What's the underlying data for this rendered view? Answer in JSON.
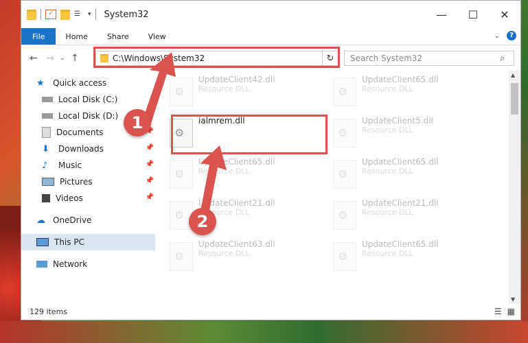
{
  "window": {
    "title": "System32"
  },
  "ribbon": {
    "tabs": [
      "File",
      "Home",
      "Share",
      "View"
    ]
  },
  "nav": {
    "address": "C:\\Windows\\System32",
    "search_placeholder": "Search System32"
  },
  "sidebar": {
    "items": [
      {
        "label": "Quick access",
        "icon": "star-icon"
      },
      {
        "label": "Local Disk (C:)",
        "icon": "drive-icon"
      },
      {
        "label": "Local Disk (D:)",
        "icon": "drive-icon"
      },
      {
        "label": "Documents",
        "icon": "documents-icon"
      },
      {
        "label": "Downloads",
        "icon": "download-icon"
      },
      {
        "label": "Music",
        "icon": "music-icon"
      },
      {
        "label": "Pictures",
        "icon": "pictures-icon"
      },
      {
        "label": "Videos",
        "icon": "videos-icon"
      },
      {
        "label": "OneDrive",
        "icon": "cloud-icon"
      },
      {
        "label": "This PC",
        "icon": "computer-icon"
      },
      {
        "label": "Network",
        "icon": "network-icon"
      }
    ]
  },
  "files": {
    "highlighted": {
      "name": "ialmrem.dll"
    },
    "left": [
      {
        "name": "UpdateClient42.dll",
        "type": "Resource DLL"
      },
      {
        "name": "UpdateClient65.dll",
        "type": "Resource DLL"
      },
      {
        "name": "UpdateClient21.dll",
        "type": "Resource DLL"
      },
      {
        "name": "UpdateClient63.dll",
        "type": "Resource DLL"
      }
    ],
    "right": [
      {
        "name": "UpdateClient65.dll",
        "type": "Resource DLL"
      },
      {
        "name": "UpdateClient5.dll",
        "type": "Resource DLL"
      },
      {
        "name": "UpdateClient65.dll",
        "type": "Resource DLL"
      },
      {
        "name": "UpdateClient21.dll",
        "type": "Resource DLL"
      },
      {
        "name": "UpdateClient65.dll",
        "type": "Resource DLL"
      }
    ]
  },
  "status": {
    "count": "129 items"
  },
  "steps": {
    "one": "1",
    "two": "2"
  },
  "colors": {
    "accent": "#1a73c7",
    "highlight": "#d9534f"
  }
}
